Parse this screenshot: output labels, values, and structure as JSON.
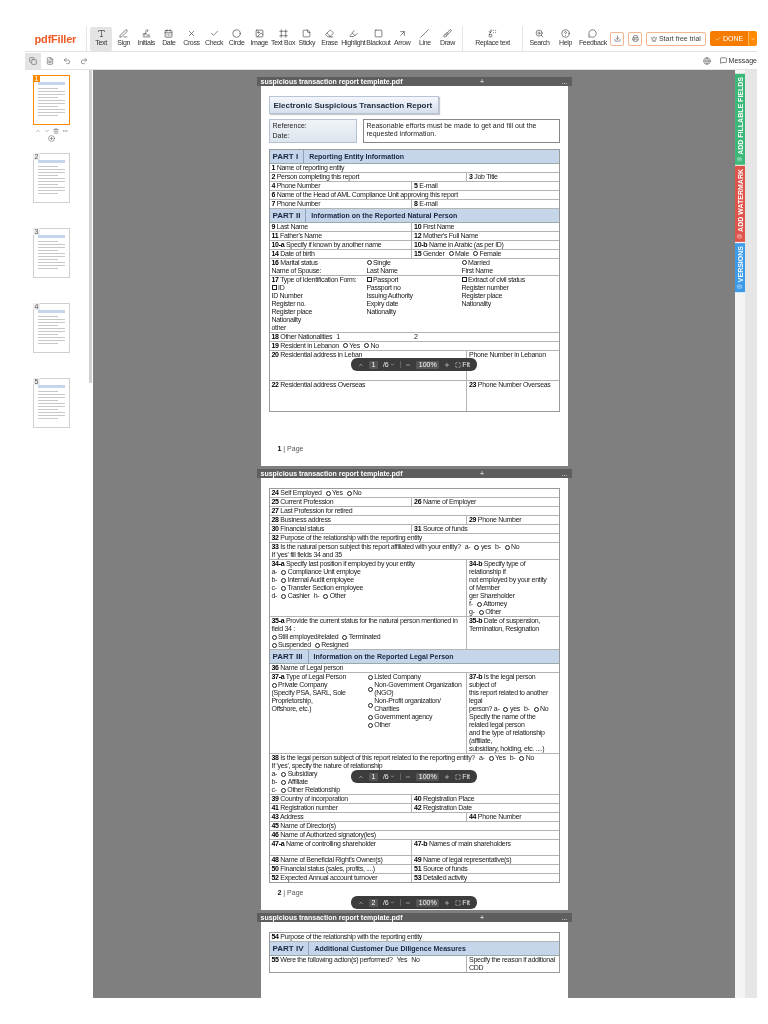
{
  "toolbar": {
    "logo": "pdfFiller",
    "tools": [
      {
        "kind": "text",
        "label": "Text",
        "selected": true
      },
      {
        "kind": "sign",
        "label": "Sign",
        "selected": false
      },
      {
        "kind": "initials",
        "label": "Initials",
        "selected": false
      },
      {
        "kind": "date",
        "label": "Date",
        "selected": false
      },
      {
        "kind": "cross",
        "label": "Cross",
        "selected": false
      },
      {
        "kind": "check",
        "label": "Check",
        "selected": false
      },
      {
        "kind": "circle",
        "label": "Circle",
        "selected": false
      },
      {
        "kind": "image",
        "label": "Image",
        "selected": false
      },
      {
        "kind": "textbox",
        "label": "Text Box",
        "selected": false
      },
      {
        "kind": "sticky",
        "label": "Sticky",
        "selected": false
      },
      {
        "kind": "erase",
        "label": "Erase",
        "selected": false
      },
      {
        "kind": "highlight",
        "label": "Highlight",
        "selected": false
      },
      {
        "kind": "blackout",
        "label": "Blackout",
        "selected": false
      },
      {
        "kind": "arrow",
        "label": "Arrow",
        "selected": false
      },
      {
        "kind": "line",
        "label": "Line",
        "selected": false
      },
      {
        "kind": "draw",
        "label": "Draw",
        "selected": false
      }
    ],
    "replace": {
      "kind": "replace",
      "label": "Replace text",
      "selected": false
    },
    "help_tools": [
      {
        "kind": "search",
        "label": "Search",
        "selected": false
      },
      {
        "kind": "help",
        "label": "Help",
        "selected": false
      },
      {
        "kind": "feedback",
        "label": "Feedback",
        "selected": false
      }
    ],
    "trial_button": "Start free trial",
    "done_button": "DONE"
  },
  "subbar": {
    "messages": "Message"
  },
  "sidebar": {
    "thumbnails": [
      {
        "label": "1",
        "selected": true
      },
      {
        "label": "2",
        "selected": false
      },
      {
        "label": "3",
        "selected": false
      },
      {
        "label": "4",
        "selected": false
      },
      {
        "label": "5",
        "selected": false
      }
    ]
  },
  "side_tabs": [
    {
      "label": "ADD FILLABLE FIELDS",
      "color": "#3cb878"
    },
    {
      "label": "ADD WATERMARK",
      "color": "#e0534a"
    },
    {
      "label": "VERSIONS",
      "color": "#3d9be9"
    }
  ],
  "zoom_bars": [
    {
      "page": "1",
      "total": "/6",
      "zoom": "100%",
      "fit": "Fit"
    },
    {
      "page": "1",
      "total": "/6",
      "zoom": "100%",
      "fit": "Fit"
    },
    {
      "page": "2",
      "total": "/6",
      "zoom": "100%",
      "fit": "Fit"
    }
  ],
  "pages": [
    {
      "header": {
        "filename": "suspicious transaction report template.pdf",
        "add": "+",
        "more": "..."
      },
      "title": "Electronic Suspicious Transaction Report",
      "reference": [
        "Reference:",
        "Date:"
      ],
      "notice": "Reasonable efforts must be made to get and fill out the requested information.",
      "rows": [
        {
          "kind": "part",
          "part": "PART I",
          "title": "Reporting Entity Information"
        },
        {
          "kind": "full",
          "cells": [
            {
              "lines": [
                [
                  "**1** Name of reporting entity"
                ]
              ]
            }
          ]
        },
        {
          "kind": "wide",
          "cells": [
            {
              "lines": [
                [
                  "**2** Person completing this report"
                ]
              ]
            },
            {
              "lines": [
                [
                  "**3** Job Title"
                ]
              ]
            }
          ]
        },
        {
          "kind": "half",
          "cells": [
            {
              "lines": [
                [
                  "**4** Phone Number"
                ]
              ]
            },
            {
              "lines": [
                [
                  "**5** E-mail"
                ]
              ]
            }
          ]
        },
        {
          "kind": "full",
          "cells": [
            {
              "lines": [
                [
                  "**6** Name of the Head of AML Compliance Unit approving this report"
                ]
              ]
            }
          ]
        },
        {
          "kind": "half",
          "cells": [
            {
              "lines": [
                [
                  "**7** Phone Number"
                ]
              ]
            },
            {
              "lines": [
                [
                  "**8** E-mail"
                ]
              ]
            }
          ]
        },
        {
          "kind": "part",
          "part": "PART II",
          "title": "Information on the Reported Natural Person"
        },
        {
          "kind": "half",
          "cells": [
            {
              "lines": [
                [
                  "**9** Last Name"
                ]
              ]
            },
            {
              "lines": [
                [
                  "**10** First Name"
                ]
              ]
            }
          ]
        },
        {
          "kind": "half",
          "cells": [
            {
              "lines": [
                [
                  "**11** Father's Name"
                ]
              ]
            },
            {
              "lines": [
                [
                  "**12** Mother's Full Name"
                ]
              ]
            }
          ]
        },
        {
          "kind": "half",
          "cells": [
            {
              "lines": [
                [
                  "**10-a** Specify if known by another name"
                ]
              ]
            },
            {
              "lines": [
                [
                  "**10-b** Name in Arabic (as per ID)"
                ]
              ]
            }
          ]
        },
        {
          "kind": "half",
          "cells": [
            {
              "lines": [
                [
                  "**14** Date of birth"
                ]
              ]
            },
            {
              "lines": [
                [
                  "**15** Gender",
                  {
                    "kind": "radio",
                    "label": "Male",
                    "selected": false
                  },
                  {
                    "kind": "radio",
                    "label": "Female",
                    "selected": false
                  }
                ]
              ]
            }
          ]
        },
        {
          "kind": "full",
          "cells": [
            {
              "columns": [
                [
                  [
                    "**16** Marital status"
                  ],
                  [
                    "Name of Spouse:"
                  ]
                ],
                [
                  [
                    {
                      "kind": "radio",
                      "label": "Single",
                      "selected": false
                    }
                  ],
                  [
                    "Last Name"
                  ]
                ],
                [
                  [
                    {
                      "kind": "radio",
                      "label": "Married",
                      "selected": false
                    }
                  ],
                  [
                    "First Name"
                  ]
                ]
              ]
            }
          ]
        },
        {
          "kind": "full",
          "cells": [
            {
              "columns": [
                [
                  [
                    "**17** Type of Identification Form:"
                  ],
                  [
                    {
                      "kind": "box",
                      "label": "ID",
                      "checked": false
                    }
                  ],
                  [
                    "ID Number"
                  ],
                  [
                    "Register no."
                  ],
                  [
                    "Register place"
                  ],
                  [
                    "Nationality"
                  ],
                  [
                    "other"
                  ]
                ],
                [
                  [
                    {
                      "kind": "box",
                      "label": "Passport",
                      "checked": false
                    }
                  ],
                  [
                    "Passport no"
                  ],
                  [
                    "Issuing Authority"
                  ],
                  [
                    "Expiry date"
                  ],
                  [
                    "Nationality"
                  ]
                ],
                [
                  [
                    {
                      "kind": "box",
                      "label": "Extract of civil status",
                      "checked": false
                    }
                  ],
                  [
                    "Register number"
                  ],
                  [
                    "Register place"
                  ],
                  [
                    "Nationality"
                  ]
                ]
              ]
            }
          ]
        },
        {
          "kind": "full",
          "cells": [
            {
              "columns": [
                [
                  [
                    "**18** Other Nationalities",
                    "1"
                  ]
                ],
                [
                  [
                    "2"
                  ]
                ]
              ]
            }
          ]
        },
        {
          "kind": "full",
          "cells": [
            {
              "lines": [
                [
                  "**19** Resident in Lebanon",
                  {
                    "kind": "radio",
                    "label": "Yes",
                    "selected": false
                  },
                  {
                    "kind": "radio",
                    "label": "No",
                    "selected": false
                  }
                ]
              ]
            }
          ]
        },
        {
          "kind": "wide-tall",
          "cells": [
            {
              "lines": [
                [
                  "**20** Residential address in Leban"
                ]
              ]
            },
            {
              "lines": [
                [
                  "Phone Number in Lebanon"
                ]
              ]
            }
          ]
        },
        {
          "kind": "wide-tall",
          "cells": [
            {
              "lines": [
                [
                  "**22** Residential address Overseas"
                ]
              ]
            },
            {
              "lines": [
                [
                  "**23** Phone Number Overseas"
                ]
              ]
            }
          ]
        }
      ],
      "footer": "**1** | Page"
    },
    {
      "header": {
        "filename": "suspicious transaction report template.pdf",
        "add": "+",
        "more": "..."
      },
      "rows": [
        {
          "kind": "full",
          "cells": [
            {
              "lines": [
                [
                  "**24** Self Employed",
                  {
                    "kind": "radio",
                    "label": "Yes",
                    "selected": false
                  },
                  {
                    "kind": "radio",
                    "label": "No",
                    "selected": false
                  }
                ]
              ]
            }
          ]
        },
        {
          "kind": "half",
          "cells": [
            {
              "lines": [
                [
                  "**25** Current Profession"
                ]
              ]
            },
            {
              "lines": [
                [
                  "**26** Name of Employer"
                ]
              ]
            }
          ]
        },
        {
          "kind": "full",
          "cells": [
            {
              "lines": [
                [
                  "**27** Last Profession for retired"
                ]
              ]
            }
          ]
        },
        {
          "kind": "wide",
          "cells": [
            {
              "lines": [
                [
                  "**28** Business address"
                ]
              ]
            },
            {
              "lines": [
                [
                  "**29** Phone Number"
                ]
              ]
            }
          ]
        },
        {
          "kind": "half",
          "cells": [
            {
              "lines": [
                [
                  "**30** Financial status"
                ]
              ]
            },
            {
              "lines": [
                [
                  "**31** Source of funds"
                ]
              ]
            }
          ]
        },
        {
          "kind": "full",
          "cells": [
            {
              "lines": [
                [
                  "**32** Purpose of the relationship with the reporting entity"
                ]
              ]
            }
          ]
        },
        {
          "kind": "full",
          "cells": [
            {
              "lines": [
                [
                  "**33** Is the natural person subject this report affiliated with your entity?",
                  "a-",
                  {
                    "kind": "radio",
                    "label": "yes",
                    "selected": false
                  },
                  "b-",
                  {
                    "kind": "radio",
                    "label": "No",
                    "selected": false
                  }
                ],
                [
                  "If 'yes' fill fields 34 and 35"
                ]
              ]
            }
          ]
        },
        {
          "kind": "wide",
          "cells": [
            {
              "lines": [
                [
                  "**34-a** Specify last position if employed by your entity"
                ],
                [
                  "a-",
                  {
                    "kind": "radio",
                    "label": "Compliance Unit employe",
                    "selected": false
                  }
                ],
                [
                  "b-",
                  {
                    "kind": "radio",
                    "label": "Internal Audit employee",
                    "selected": false
                  }
                ],
                [
                  "c-",
                  {
                    "kind": "radio",
                    "label": "Transfer Section employee",
                    "selected": false
                  }
                ],
                [
                  "d-",
                  {
                    "kind": "radio",
                    "label": "Cashier",
                    "selected": false
                  },
                  "h-",
                  {
                    "kind": "radio",
                    "label": "Other",
                    "selected": false
                  }
                ]
              ]
            },
            {
              "lines": [
                [
                  "**34-b** Specify type of relationship if"
                ],
                [
                  "not employed by your entity"
                ],
                [
                  "of Member"
                ],
                [
                  "ger Shareholder"
                ],
                [
                  "f-",
                  {
                    "kind": "radio",
                    "label": "Attorney",
                    "selected": false
                  }
                ],
                [
                  "g-",
                  {
                    "kind": "radio",
                    "label": "Other",
                    "selected": false
                  }
                ]
              ]
            }
          ]
        },
        {
          "kind": "wide",
          "cells": [
            {
              "lines": [
                [
                  "**35-a** Provide the current status for the natural person mentioned in field 34 :"
                ],
                [
                  {
                    "kind": "radio",
                    "label": "Still employed/related",
                    "selected": false
                  },
                  {
                    "kind": "radio",
                    "label": "Terminated",
                    "selected": false
                  }
                ],
                [
                  {
                    "kind": "radio",
                    "label": "Suspended",
                    "selected": false
                  },
                  {
                    "kind": "radio",
                    "label": "Resigned",
                    "selected": false
                  }
                ]
              ]
            },
            {
              "lines": [
                [
                  "**35-b** Date of suspension,"
                ],
                [
                  "Termination, Resignation"
                ]
              ]
            }
          ]
        },
        {
          "kind": "part",
          "part": "PART III",
          "title": "Information on the Reported Legal Person"
        },
        {
          "kind": "full",
          "cells": [
            {
              "lines": [
                [
                  "**36** Name of Legal person"
                ]
              ]
            }
          ]
        },
        {
          "kind": "wide",
          "cells": [
            {
              "columns": [
                [
                  [
                    "**37-a** Type of Legal Person"
                  ],
                  [
                    {
                      "kind": "radio",
                      "label": "Private Company",
                      "selected": false
                    }
                  ],
                  [
                    "(Specify PSA, SARL, Sole Proprietorship,"
                  ],
                  [
                    "Offshore, etc.)"
                  ]
                ],
                [
                  [
                    {
                      "kind": "radio",
                      "label": "Listed Company",
                      "selected": false
                    }
                  ],
                  [
                    {
                      "kind": "radio",
                      "label": "Non-Government Organization (NGO)",
                      "selected": false
                    }
                  ],
                  [
                    {
                      "kind": "radio",
                      "label": "Non-Profit organization/ Charities",
                      "selected": false
                    }
                  ],
                  [
                    {
                      "kind": "radio",
                      "label": "Government agency",
                      "selected": false
                    }
                  ],
                  [
                    {
                      "kind": "radio",
                      "label": "Other",
                      "selected": false
                    }
                  ]
                ]
              ]
            },
            {
              "lines": [
                [
                  "**37-b** Is the legal person subject of"
                ],
                [
                  "this report related to another legal"
                ],
                [
                  "person? a-",
                  {
                    "kind": "radio",
                    "label": "yes",
                    "selected": false
                  },
                  "b-",
                  {
                    "kind": "radio",
                    "label": "No",
                    "selected": false
                  }
                ],
                [
                  "Specify the name of the related legal person"
                ],
                [
                  "and the type of relationship (affiliate,"
                ],
                [
                  "subsidiary, holding, etc. ....)"
                ]
              ]
            }
          ]
        },
        {
          "kind": "full",
          "cells": [
            {
              "lines": [
                [
                  "**38** Is the legal person subject of this report related to the reporting entity?",
                  "a-",
                  {
                    "kind": "radio",
                    "label": "Yes",
                    "selected": false
                  },
                  "b-",
                  {
                    "kind": "radio",
                    "label": "No",
                    "selected": false
                  }
                ],
                [
                  "If 'yes', specify the nature of relationship"
                ],
                [
                  "a-",
                  {
                    "kind": "radio",
                    "label": "Subsidiary",
                    "selected": false
                  }
                ],
                [
                  "b-",
                  {
                    "kind": "radio",
                    "label": "Affiliate",
                    "selected": false
                  }
                ],
                [
                  "c-",
                  {
                    "kind": "radio",
                    "label": "Other Relationship",
                    "selected": false
                  }
                ]
              ]
            }
          ]
        },
        {
          "kind": "half",
          "cells": [
            {
              "lines": [
                [
                  "**39** Country of incorporation"
                ]
              ]
            },
            {
              "lines": [
                [
                  "**40** Registration Place"
                ]
              ]
            }
          ]
        },
        {
          "kind": "half",
          "cells": [
            {
              "lines": [
                [
                  "**41** Registration number"
                ]
              ]
            },
            {
              "lines": [
                [
                  "**42** Registration Date"
                ]
              ]
            }
          ]
        },
        {
          "kind": "wide",
          "cells": [
            {
              "lines": [
                [
                  "**43** Address"
                ]
              ]
            },
            {
              "lines": [
                [
                  "**44** Phone Number"
                ]
              ]
            }
          ]
        },
        {
          "kind": "full",
          "cells": [
            {
              "lines": [
                [
                  "**45** Name of Director(s)"
                ]
              ]
            }
          ]
        },
        {
          "kind": "full",
          "cells": [
            {
              "lines": [
                [
                  "**46** Name of Authorized signatory(ies)"
                ]
              ]
            }
          ]
        },
        {
          "kind": "half-tall",
          "cells": [
            {
              "lines": [
                [
                  "**47-a** Name of controlling shareholder"
                ]
              ]
            },
            {
              "lines": [
                [
                  "**47-b** Names of main shareholders"
                ]
              ]
            }
          ]
        },
        {
          "kind": "half",
          "cells": [
            {
              "lines": [
                [
                  "**48** Name of Beneficial Right's Owner(s)"
                ]
              ]
            },
            {
              "lines": [
                [
                  "**49** Name of legal representative(s)"
                ]
              ]
            }
          ]
        },
        {
          "kind": "half",
          "cells": [
            {
              "lines": [
                [
                  "**50** Financial status (sales, profits, ....)"
                ]
              ]
            },
            {
              "lines": [
                [
                  "**51** Source of funds"
                ]
              ]
            }
          ]
        },
        {
          "kind": "half",
          "cells": [
            {
              "lines": [
                [
                  "**52** Expected Annual account turnover"
                ]
              ]
            },
            {
              "lines": [
                [
                  "**53** Detailed activity"
                ]
              ]
            }
          ]
        }
      ],
      "footer": "**2** | Page"
    },
    {
      "header": {
        "filename": "suspicious transaction report template.pdf",
        "add": "+",
        "more": "..."
      },
      "rows": [
        {
          "kind": "full",
          "cells": [
            {
              "lines": [
                [
                  "**54** Purpose of the relationship with the reporting entity"
                ]
              ]
            }
          ]
        },
        {
          "kind": "part",
          "part": "PART IV",
          "title": "Additional Customer Due Diligence Measures"
        },
        {
          "kind": "wide",
          "cells": [
            {
              "lines": [
                [
                  "**55** Were the following action(s) performed?",
                  "Yes",
                  "No"
                ]
              ]
            },
            {
              "lines": [
                [
                  "Specify the reason if additional CDD"
                ]
              ]
            }
          ]
        }
      ]
    }
  ]
}
